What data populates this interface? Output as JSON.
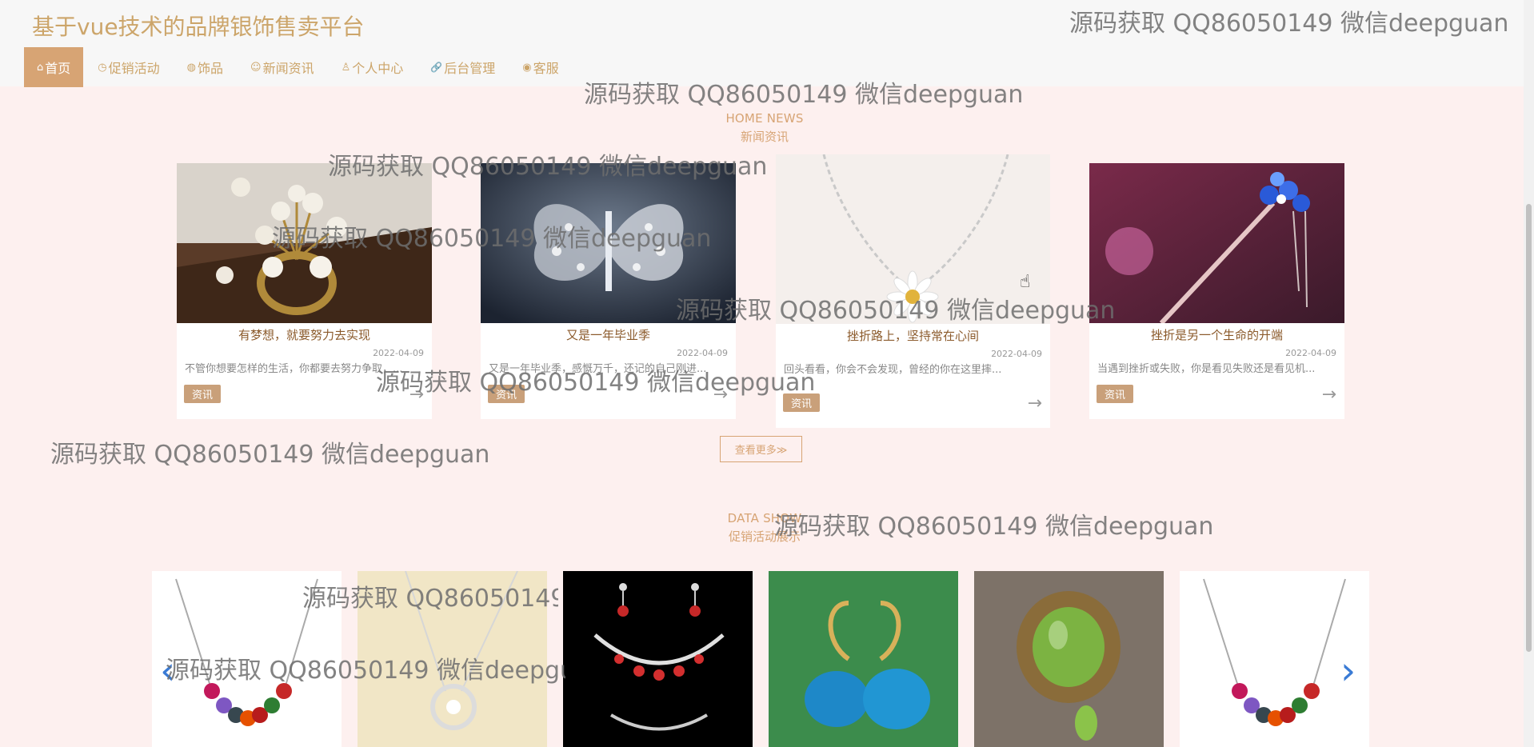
{
  "header": {
    "site_title": "基于vue技术的品牌银饰售卖平台",
    "nav": [
      {
        "icon": "⌂",
        "label": "首页"
      },
      {
        "icon": "◷",
        "label": "促销活动"
      },
      {
        "icon": "◍",
        "label": "饰品"
      },
      {
        "icon": "☺",
        "label": "新闻资讯"
      },
      {
        "icon": "♙",
        "label": "个人中心"
      },
      {
        "icon": "🔗",
        "label": "后台管理"
      },
      {
        "icon": "◉",
        "label": "客服"
      }
    ]
  },
  "news_section": {
    "title_en": "HOME NEWS",
    "title_cn": "新闻资讯",
    "cards": [
      {
        "title": "有梦想，就要努力去实现",
        "date": "2022-04-09",
        "summary": "不管你想要怎样的生活，你都要去努力争取，...",
        "tag": "资讯",
        "arrow": "→"
      },
      {
        "title": "又是一年毕业季",
        "date": "2022-04-09",
        "summary": "又是一年毕业季，感慨万千，还记的自己刚进...",
        "tag": "资讯",
        "arrow": "→"
      },
      {
        "title": "挫折路上，坚持常在心间",
        "date": "2022-04-09",
        "summary": "回头看看，你会不会发现，曾经的你在这里摔...",
        "tag": "资讯",
        "arrow": "→"
      },
      {
        "title": "挫折是另一个生命的开端",
        "date": "2022-04-09",
        "summary": "当遇到挫折或失败，你是看见失败还是看见机...",
        "tag": "资讯",
        "arrow": "→"
      }
    ],
    "more_label": "查看更多≫"
  },
  "promo_section": {
    "title_en": "DATA SHOW",
    "title_cn": "促销活动展示"
  },
  "carousel": {
    "prev": "‹",
    "next": "›"
  },
  "watermark": "源码获取 QQ86050149 微信deepguan",
  "colors": {
    "accent": "#d7a474",
    "page_bg": "#fdf0ef",
    "header_bg": "#f7f7f7",
    "arrow_blue": "#3a7bd5"
  }
}
